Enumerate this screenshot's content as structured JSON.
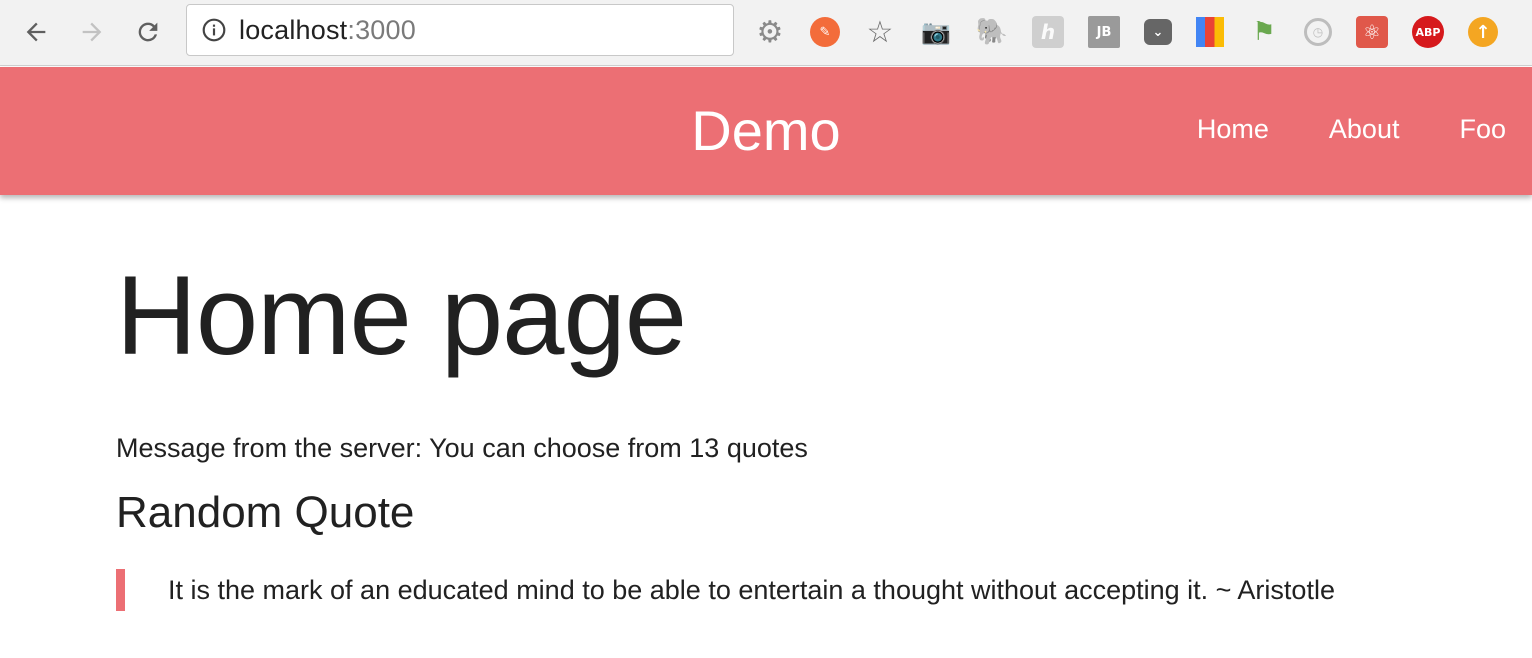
{
  "browser": {
    "url_host": "localhost",
    "url_port": ":3000",
    "extensions": [
      {
        "name": "settings-gear-icon",
        "glyph": "⚙"
      },
      {
        "name": "brush-icon",
        "glyph": "✎"
      },
      {
        "name": "bookmark-star-icon",
        "glyph": "☆"
      },
      {
        "name": "camera-icon",
        "glyph": "📷"
      },
      {
        "name": "evernote-icon",
        "glyph": "🐘"
      },
      {
        "name": "h-extension-icon",
        "glyph": "h"
      },
      {
        "name": "jb-icon",
        "glyph": "JB"
      },
      {
        "name": "pocket-icon",
        "glyph": "⌄"
      },
      {
        "name": "lighthouse-icon",
        "glyph": ""
      },
      {
        "name": "green-extension-icon",
        "glyph": "⚑"
      },
      {
        "name": "clock-icon",
        "glyph": "◷"
      },
      {
        "name": "react-devtools-icon",
        "glyph": "⚛"
      },
      {
        "name": "adblock-plus-icon",
        "glyph": "ABP"
      },
      {
        "name": "update-arrow-icon",
        "glyph": "↑"
      }
    ]
  },
  "header": {
    "brand": "Demo",
    "nav": [
      "Home",
      "About",
      "Foo"
    ],
    "color": "#ec6f74"
  },
  "main": {
    "title": "Home page",
    "server_message": "Message from the server: You can choose from 13 quotes",
    "section_title": "Random Quote",
    "quote": "It is the mark of an educated mind to be able to entertain a thought without accepting it. ~ Aristotle"
  }
}
